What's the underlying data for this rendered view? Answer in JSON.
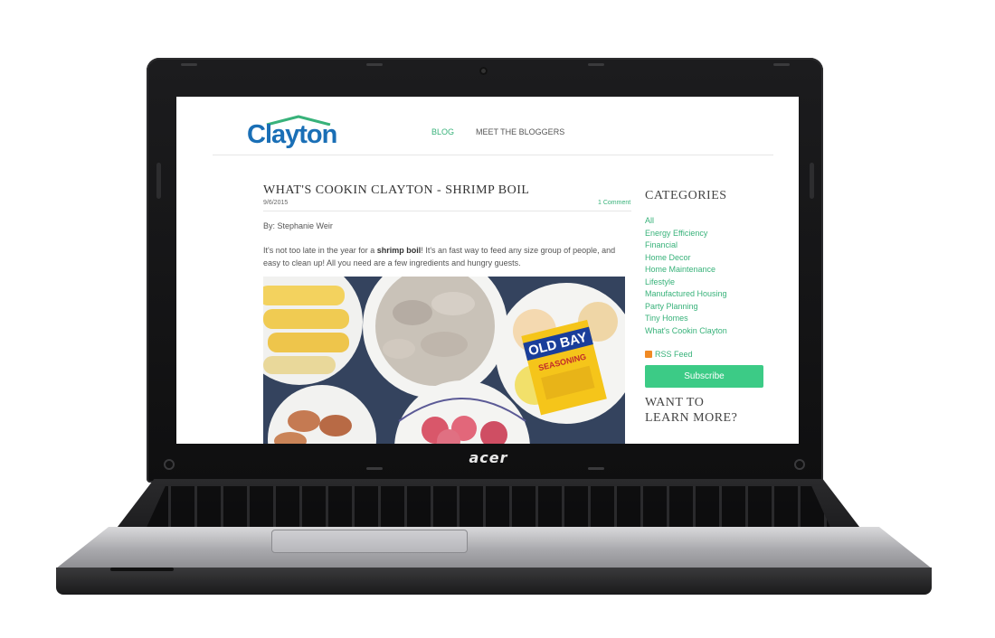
{
  "device": {
    "brand": "acer"
  },
  "header": {
    "logo_text": "Clayton",
    "logo_color": "#1a6fb6",
    "roof_color": "#38b27a",
    "nav": [
      {
        "label": "BLOG",
        "active": true
      },
      {
        "label": "MEET THE BLOGGERS",
        "active": false
      }
    ]
  },
  "post": {
    "title": "WHAT'S COOKIN CLAYTON - SHRIMP BOIL",
    "date": "9/6/2015",
    "comments": "1 Comment",
    "byline": "By: Stephanie Weir",
    "intro_before": "It's not too late in the year for a ",
    "intro_bold": "shrimp boil",
    "intro_after": "! It's an fast way to feed any size group of people, and easy to clean up! All you need are a few ingredients and hungry guests.",
    "photo_label": "OLD BAY",
    "photo_sublabel": "SEASONING"
  },
  "sidebar": {
    "categories_title": "CATEGORIES",
    "categories": [
      "All",
      "Energy Efficiency",
      "Financial",
      "Home Decor",
      "Home Maintenance",
      "Lifestyle",
      "Manufactured Housing",
      "Party Planning",
      "Tiny Homes",
      "What's Cookin Clayton"
    ],
    "rss_label": "RSS Feed",
    "subscribe_label": "Subscribe",
    "learn_more": "WANT TO LEARN MORE?"
  },
  "colors": {
    "accent": "#38b27a",
    "button": "#3ccb86"
  }
}
